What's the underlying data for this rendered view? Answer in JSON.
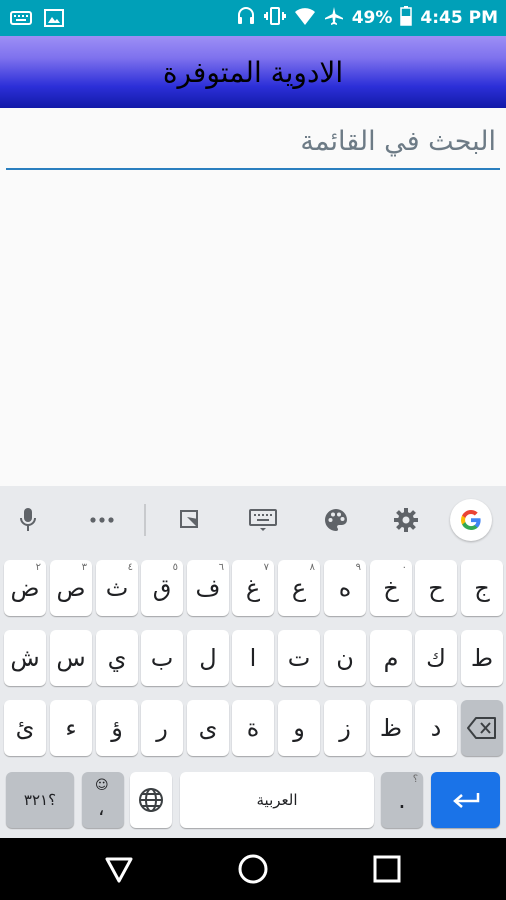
{
  "status_bar": {
    "battery": "49%",
    "time": "4:45 PM",
    "icons": [
      "keyboard-icon",
      "image-icon",
      "headset-icon",
      "vibrate-icon",
      "wifi-icon",
      "airplane-icon",
      "battery-icon"
    ]
  },
  "app_bar": {
    "title": "الادوية المتوفرة"
  },
  "search": {
    "placeholder": "البحث في القائمة"
  },
  "keyboard": {
    "toolbar_icons": [
      "mic-icon",
      "more-icon",
      "clipboard-icon",
      "keyboard-icon",
      "palette-icon",
      "settings-icon",
      "google-icon"
    ],
    "row1": [
      {
        "label": "ج",
        "hint": ""
      },
      {
        "label": "ح",
        "hint": ""
      },
      {
        "label": "خ",
        "hint": "٠"
      },
      {
        "label": "ه",
        "hint": "٩"
      },
      {
        "label": "ع",
        "hint": "٨"
      },
      {
        "label": "غ",
        "hint": "٧"
      },
      {
        "label": "ف",
        "hint": "٦"
      },
      {
        "label": "ق",
        "hint": "٥"
      },
      {
        "label": "ث",
        "hint": "٤"
      },
      {
        "label": "ص",
        "hint": "٣"
      },
      {
        "label": "ض",
        "hint": "٢"
      }
    ],
    "row2": [
      "ط",
      "ك",
      "م",
      "ن",
      "ت",
      "ا",
      "ل",
      "ب",
      "ي",
      "س",
      "ش"
    ],
    "row3": [
      "د",
      "ظ",
      "ز",
      "و",
      "ة",
      "ى",
      "ر",
      "ؤ",
      "ء",
      "ئ"
    ],
    "row4": {
      "numbers_label": "؟٣٢١",
      "emoji_comma": "،",
      "space_label": "العربية",
      "period": ".",
      "period_hint": "؟"
    }
  },
  "colors": {
    "status_bar": "#00a0b8",
    "app_bar_top": "#9d8ff5",
    "app_bar_bottom": "#121aa8",
    "search_underline": "#2a7fbf",
    "keyboard_bg": "#e8eaed",
    "enter_key": "#1a73e8"
  }
}
